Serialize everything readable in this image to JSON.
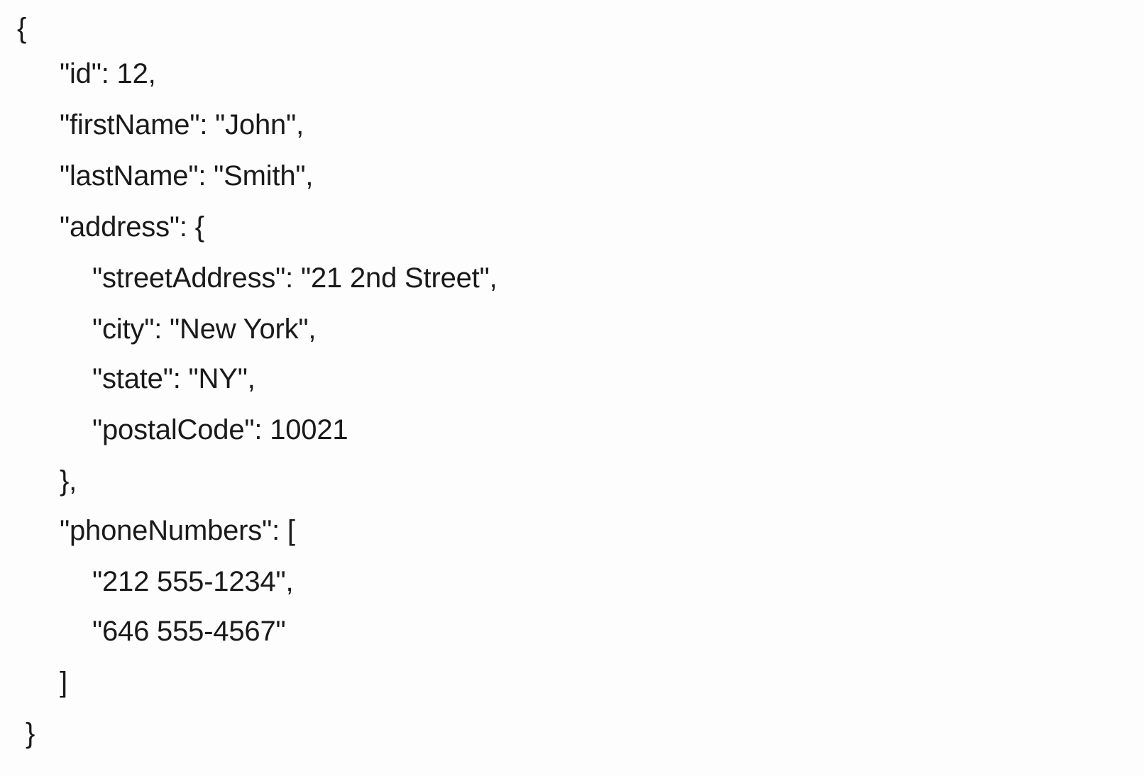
{
  "document": {
    "lines": [
      "{",
      "\"id\": 12,",
      "\"firstName\": \"John\",",
      "\"lastName\": \"Smith\",",
      "\"address\": {",
      "\"streetAddress\": \"21 2nd Street\",",
      "\"city\": \"New York\",",
      "\"state\": \"NY\",",
      "\"postalCode\": 10021",
      "},",
      "\"phoneNumbers\": [",
      "\"212 555-1234\",",
      "\"646 555-4567\"",
      "]",
      "}"
    ]
  }
}
